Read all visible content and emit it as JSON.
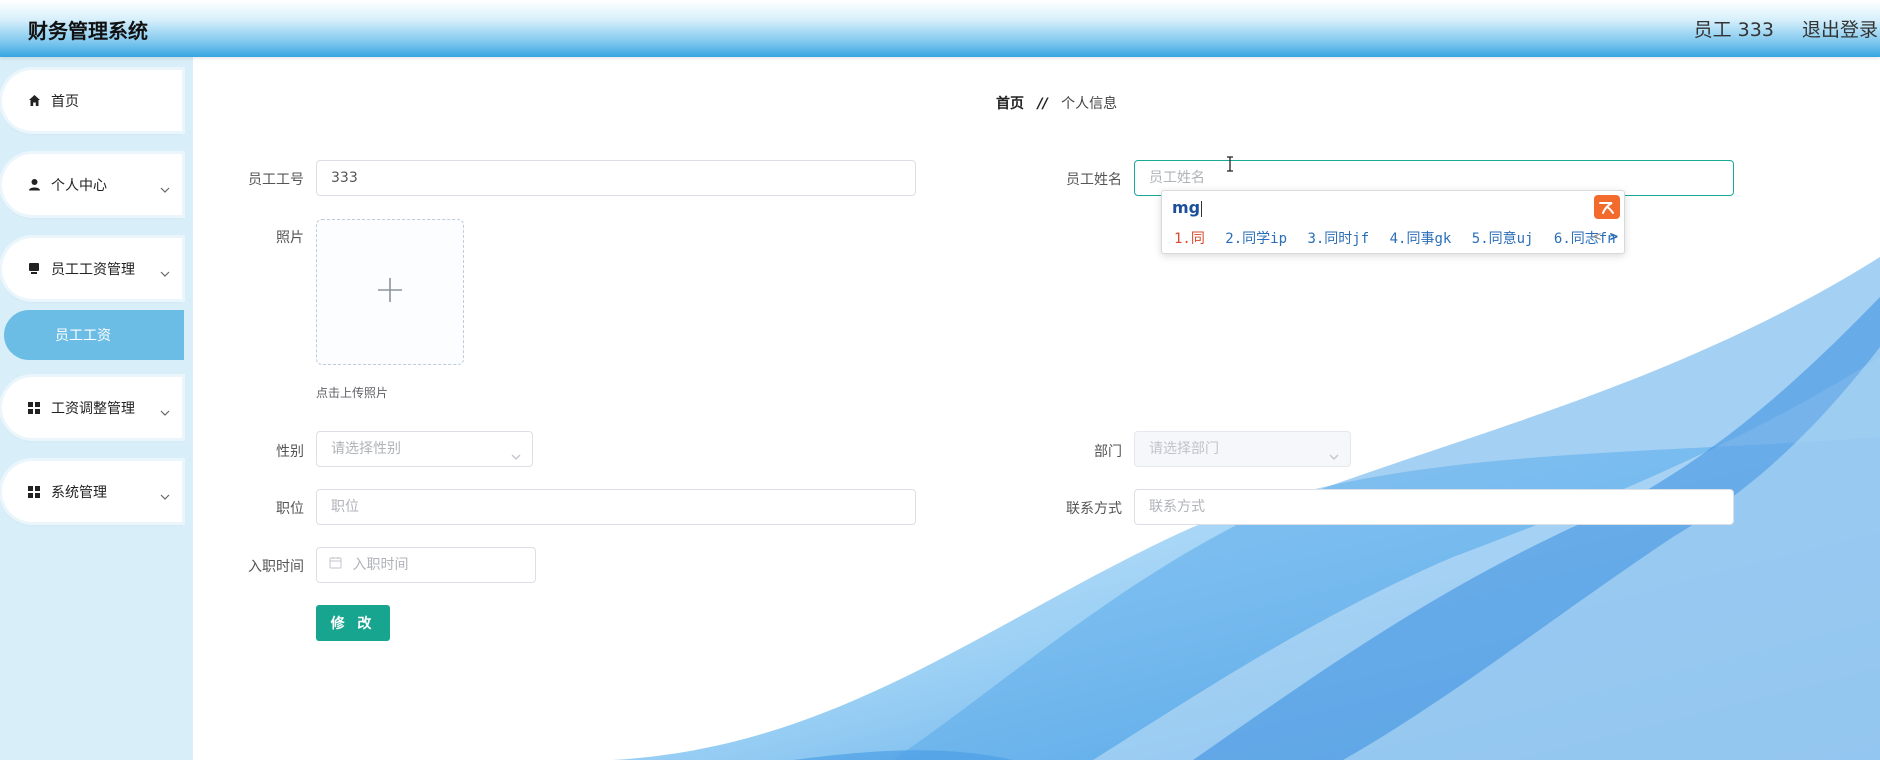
{
  "header": {
    "app_title": "财务管理系统",
    "user_label": "员工 333",
    "logout_label": "退出登录"
  },
  "sidebar": {
    "items": [
      {
        "label": "首页",
        "icon": "home-icon"
      },
      {
        "label": "个人中心",
        "icon": "user-icon"
      },
      {
        "label": "员工工资管理",
        "icon": "card-icon"
      },
      {
        "label": "工资调整管理",
        "icon": "grid-icon"
      },
      {
        "label": "系统管理",
        "icon": "grid-icon"
      }
    ],
    "active_subitem": "员工工资"
  },
  "breadcrumb": {
    "home": "首页",
    "separator": "//",
    "current": "个人信息"
  },
  "form": {
    "employee_id": {
      "label": "员工工号",
      "value": "333"
    },
    "employee_name": {
      "label": "员工姓名",
      "value": "",
      "placeholder": "员工姓名"
    },
    "photo": {
      "label": "照片",
      "hint": "点击上传照片"
    },
    "gender": {
      "label": "性别",
      "placeholder": "请选择性别"
    },
    "department": {
      "label": "部门",
      "placeholder": "请选择部门"
    },
    "position": {
      "label": "职位",
      "placeholder": "职位"
    },
    "contact": {
      "label": "联系方式",
      "placeholder": "联系方式"
    },
    "hire_date": {
      "label": "入职时间",
      "placeholder": "入职时间"
    },
    "submit_label": "修 改"
  },
  "ime": {
    "composition": "mg",
    "candidates": [
      "1.同",
      "2.同学ip",
      "3.同时jf",
      "4.同事gk",
      "5.同意uj",
      "6.同志fn"
    ],
    "prev": "<",
    "next": ">"
  },
  "colors": {
    "accent": "#17a590",
    "sidebar_bg": "#d8eef8",
    "active_sub": "#6cbde5",
    "header_blue": "#37a5e2"
  }
}
